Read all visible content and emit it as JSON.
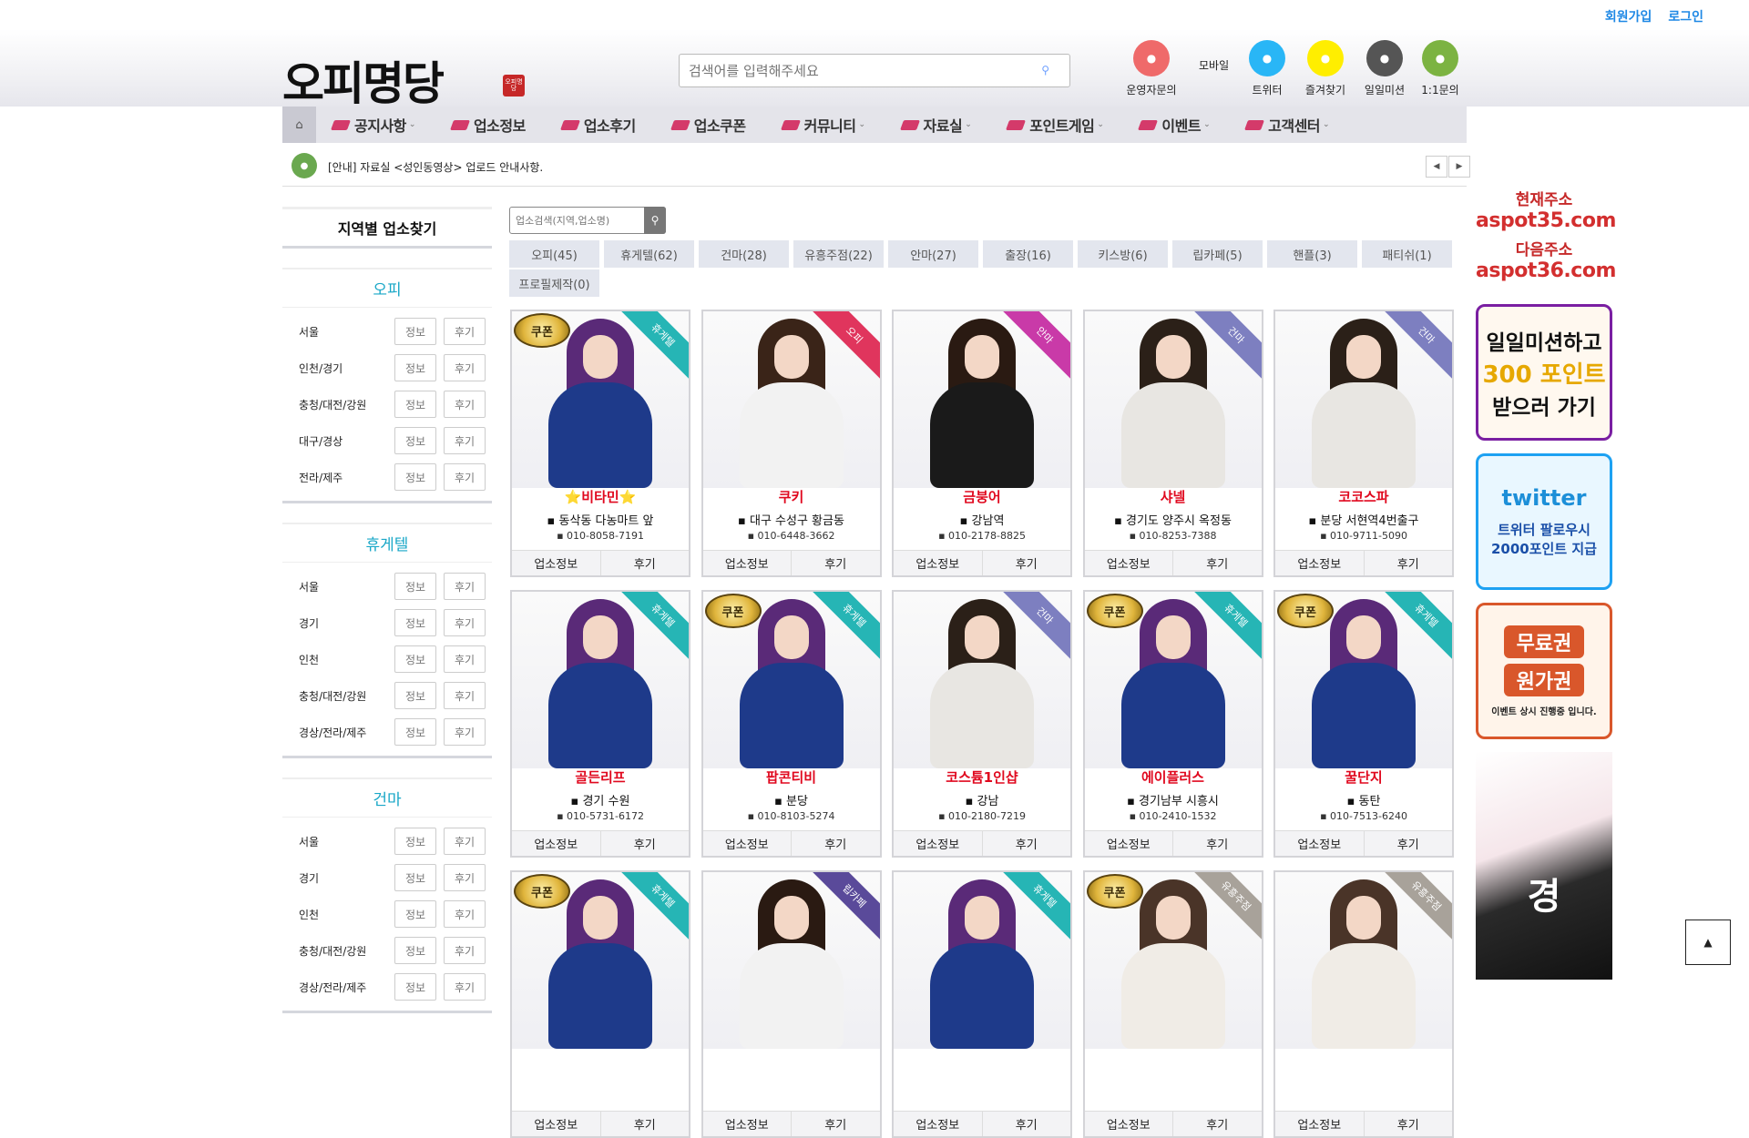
{
  "toplinks": [
    "회원가입",
    "로그인"
  ],
  "logo": {
    "text": "오피명당",
    "seal": "오피명당"
  },
  "search": {
    "placeholder": "검색어를 입력해주세요"
  },
  "mobile_label": "모바일",
  "quick": [
    {
      "label": "운영자문의",
      "color": "#ef6a6a",
      "icon": "chat-icon"
    },
    {
      "label": "트위터",
      "color": "#29b6f6",
      "icon": "twitter-icon"
    },
    {
      "label": "즐겨찾기",
      "color": "#ffee00",
      "icon": "star-icon"
    },
    {
      "label": "일일미션",
      "color": "#555555",
      "icon": "mission-icon"
    },
    {
      "label": "1:1문의",
      "color": "#7cb342",
      "icon": "question-icon"
    }
  ],
  "nav": [
    "공지사항",
    "업소정보",
    "업소후기",
    "업소쿠폰",
    "커뮤니티",
    "자료실",
    "포인트게임",
    "이벤트",
    "고객센터"
  ],
  "notice": "[안내] 자료실 <성인동영상> 업로드 안내사항.",
  "sidebar": {
    "title": "지역별 업소찾기",
    "info_label": "정보",
    "review_label": "후기",
    "groups": [
      {
        "title": "오피",
        "regions": [
          "서울",
          "인천/경기",
          "충청/대전/강원",
          "대구/경상",
          "전라/제주"
        ]
      },
      {
        "title": "휴게텔",
        "regions": [
          "서울",
          "경기",
          "인천",
          "충청/대전/강원",
          "경상/전라/제주"
        ]
      },
      {
        "title": "건마",
        "regions": [
          "서울",
          "경기",
          "인천",
          "충청/대전/강원",
          "경상/전라/제주"
        ]
      }
    ]
  },
  "biz_search": {
    "placeholder": "업소검색(지역,업소명)"
  },
  "categories": [
    "오피(45)",
    "휴게텔(62)",
    "건마(28)",
    "유흥주점(22)",
    "안마(27)",
    "출장(16)",
    "키스방(6)",
    "립카페(5)",
    "핸플(3)",
    "패티쉬(1)",
    "프로필제작(0)"
  ],
  "card_buttons": {
    "info": "업소정보",
    "review": "후기"
  },
  "cards": [
    {
      "name": "⭐비타민⭐",
      "loc": "동삭동 다농마트 앞",
      "phone": "010-8058-7191",
      "tag": "휴게텔",
      "tag_color": "#26b5b5",
      "coupon": true,
      "hair": "#5a2a78",
      "outfit": "#1e3a8a"
    },
    {
      "name": "쿠키",
      "loc": "대구 수성구 황금동",
      "phone": "010-6448-3662",
      "tag": "오피",
      "tag_color": "#e0355d",
      "coupon": false,
      "hair": "#3a2418",
      "outfit": "#f2f2f2"
    },
    {
      "name": "금붕어",
      "loc": "강남역",
      "phone": "010-2178-8825",
      "tag": "안마",
      "tag_color": "#c93aa8",
      "coupon": false,
      "hair": "#2a1a12",
      "outfit": "#1a1a1a"
    },
    {
      "name": "샤넬",
      "loc": "경기도 양주시 옥정동",
      "phone": "010-8253-7388",
      "tag": "건마",
      "tag_color": "#7d7fc0",
      "coupon": false,
      "hair": "#2b2018",
      "outfit": "#e8e6e2"
    },
    {
      "name": "코코스파",
      "loc": "분당 서현역4번출구",
      "phone": "010-9711-5090",
      "tag": "건마",
      "tag_color": "#7d7fc0",
      "coupon": false,
      "hair": "#2b2018",
      "outfit": "#e8e6e2"
    },
    {
      "name": "골든리프",
      "loc": "경기 수원",
      "phone": "010-5731-6172",
      "tag": "휴게텔",
      "tag_color": "#26b5b5",
      "coupon": false,
      "hair": "#5a2a78",
      "outfit": "#1e3a8a"
    },
    {
      "name": "팝콘티비",
      "loc": "분당",
      "phone": "010-8103-5274",
      "tag": "휴게텔",
      "tag_color": "#26b5b5",
      "coupon": true,
      "hair": "#5a2a78",
      "outfit": "#1e3a8a"
    },
    {
      "name": "코스튬1인샵",
      "loc": "강남",
      "phone": "010-2180-7219",
      "tag": "건마",
      "tag_color": "#7d7fc0",
      "coupon": false,
      "hair": "#2b2018",
      "outfit": "#e8e6e2"
    },
    {
      "name": "에이플러스",
      "loc": "경기남부 시흥시",
      "phone": "010-2410-1532",
      "tag": "휴게텔",
      "tag_color": "#26b5b5",
      "coupon": true,
      "hair": "#5a2a78",
      "outfit": "#1e3a8a"
    },
    {
      "name": "꿀단지",
      "loc": "동탄",
      "phone": "010-7513-6240",
      "tag": "휴게텔",
      "tag_color": "#26b5b5",
      "coupon": true,
      "hair": "#5a2a78",
      "outfit": "#1e3a8a"
    },
    {
      "name": "",
      "loc": "",
      "phone": "",
      "tag": "휴게텔",
      "tag_color": "#26b5b5",
      "coupon": true,
      "hair": "#5a2a78",
      "outfit": "#1e3a8a"
    },
    {
      "name": "",
      "loc": "",
      "phone": "",
      "tag": "립카페",
      "tag_color": "#5a4a9a",
      "coupon": false,
      "hair": "#2a1a12",
      "outfit": "#f2f2f2"
    },
    {
      "name": "",
      "loc": "",
      "phone": "",
      "tag": "휴게텔",
      "tag_color": "#26b5b5",
      "coupon": false,
      "hair": "#5a2a78",
      "outfit": "#1e3a8a"
    },
    {
      "name": "",
      "loc": "",
      "phone": "",
      "tag": "유흥주점",
      "tag_color": "#a8a29a",
      "coupon": true,
      "hair": "#4a3428",
      "outfit": "#f0ece6"
    },
    {
      "name": "",
      "loc": "",
      "phone": "",
      "tag": "유흥주점",
      "tag_color": "#a8a29a",
      "coupon": false,
      "hair": "#4a3428",
      "outfit": "#f0ece6"
    }
  ],
  "right": {
    "current_label": "현재주소",
    "current_url": "aspot35.com",
    "next_label": "다음주소",
    "next_url": "aspot36.com",
    "banner_mission": [
      "일일미션하고",
      "300 포인트",
      "받으러 가기"
    ],
    "banner_twitter": [
      "twitter",
      "트위터 팔로우시",
      "2000포인트 지급"
    ],
    "banner_free": [
      "무료권",
      "원가권",
      "이벤트 상시 진행중 입니다."
    ],
    "banner_art": "경"
  }
}
